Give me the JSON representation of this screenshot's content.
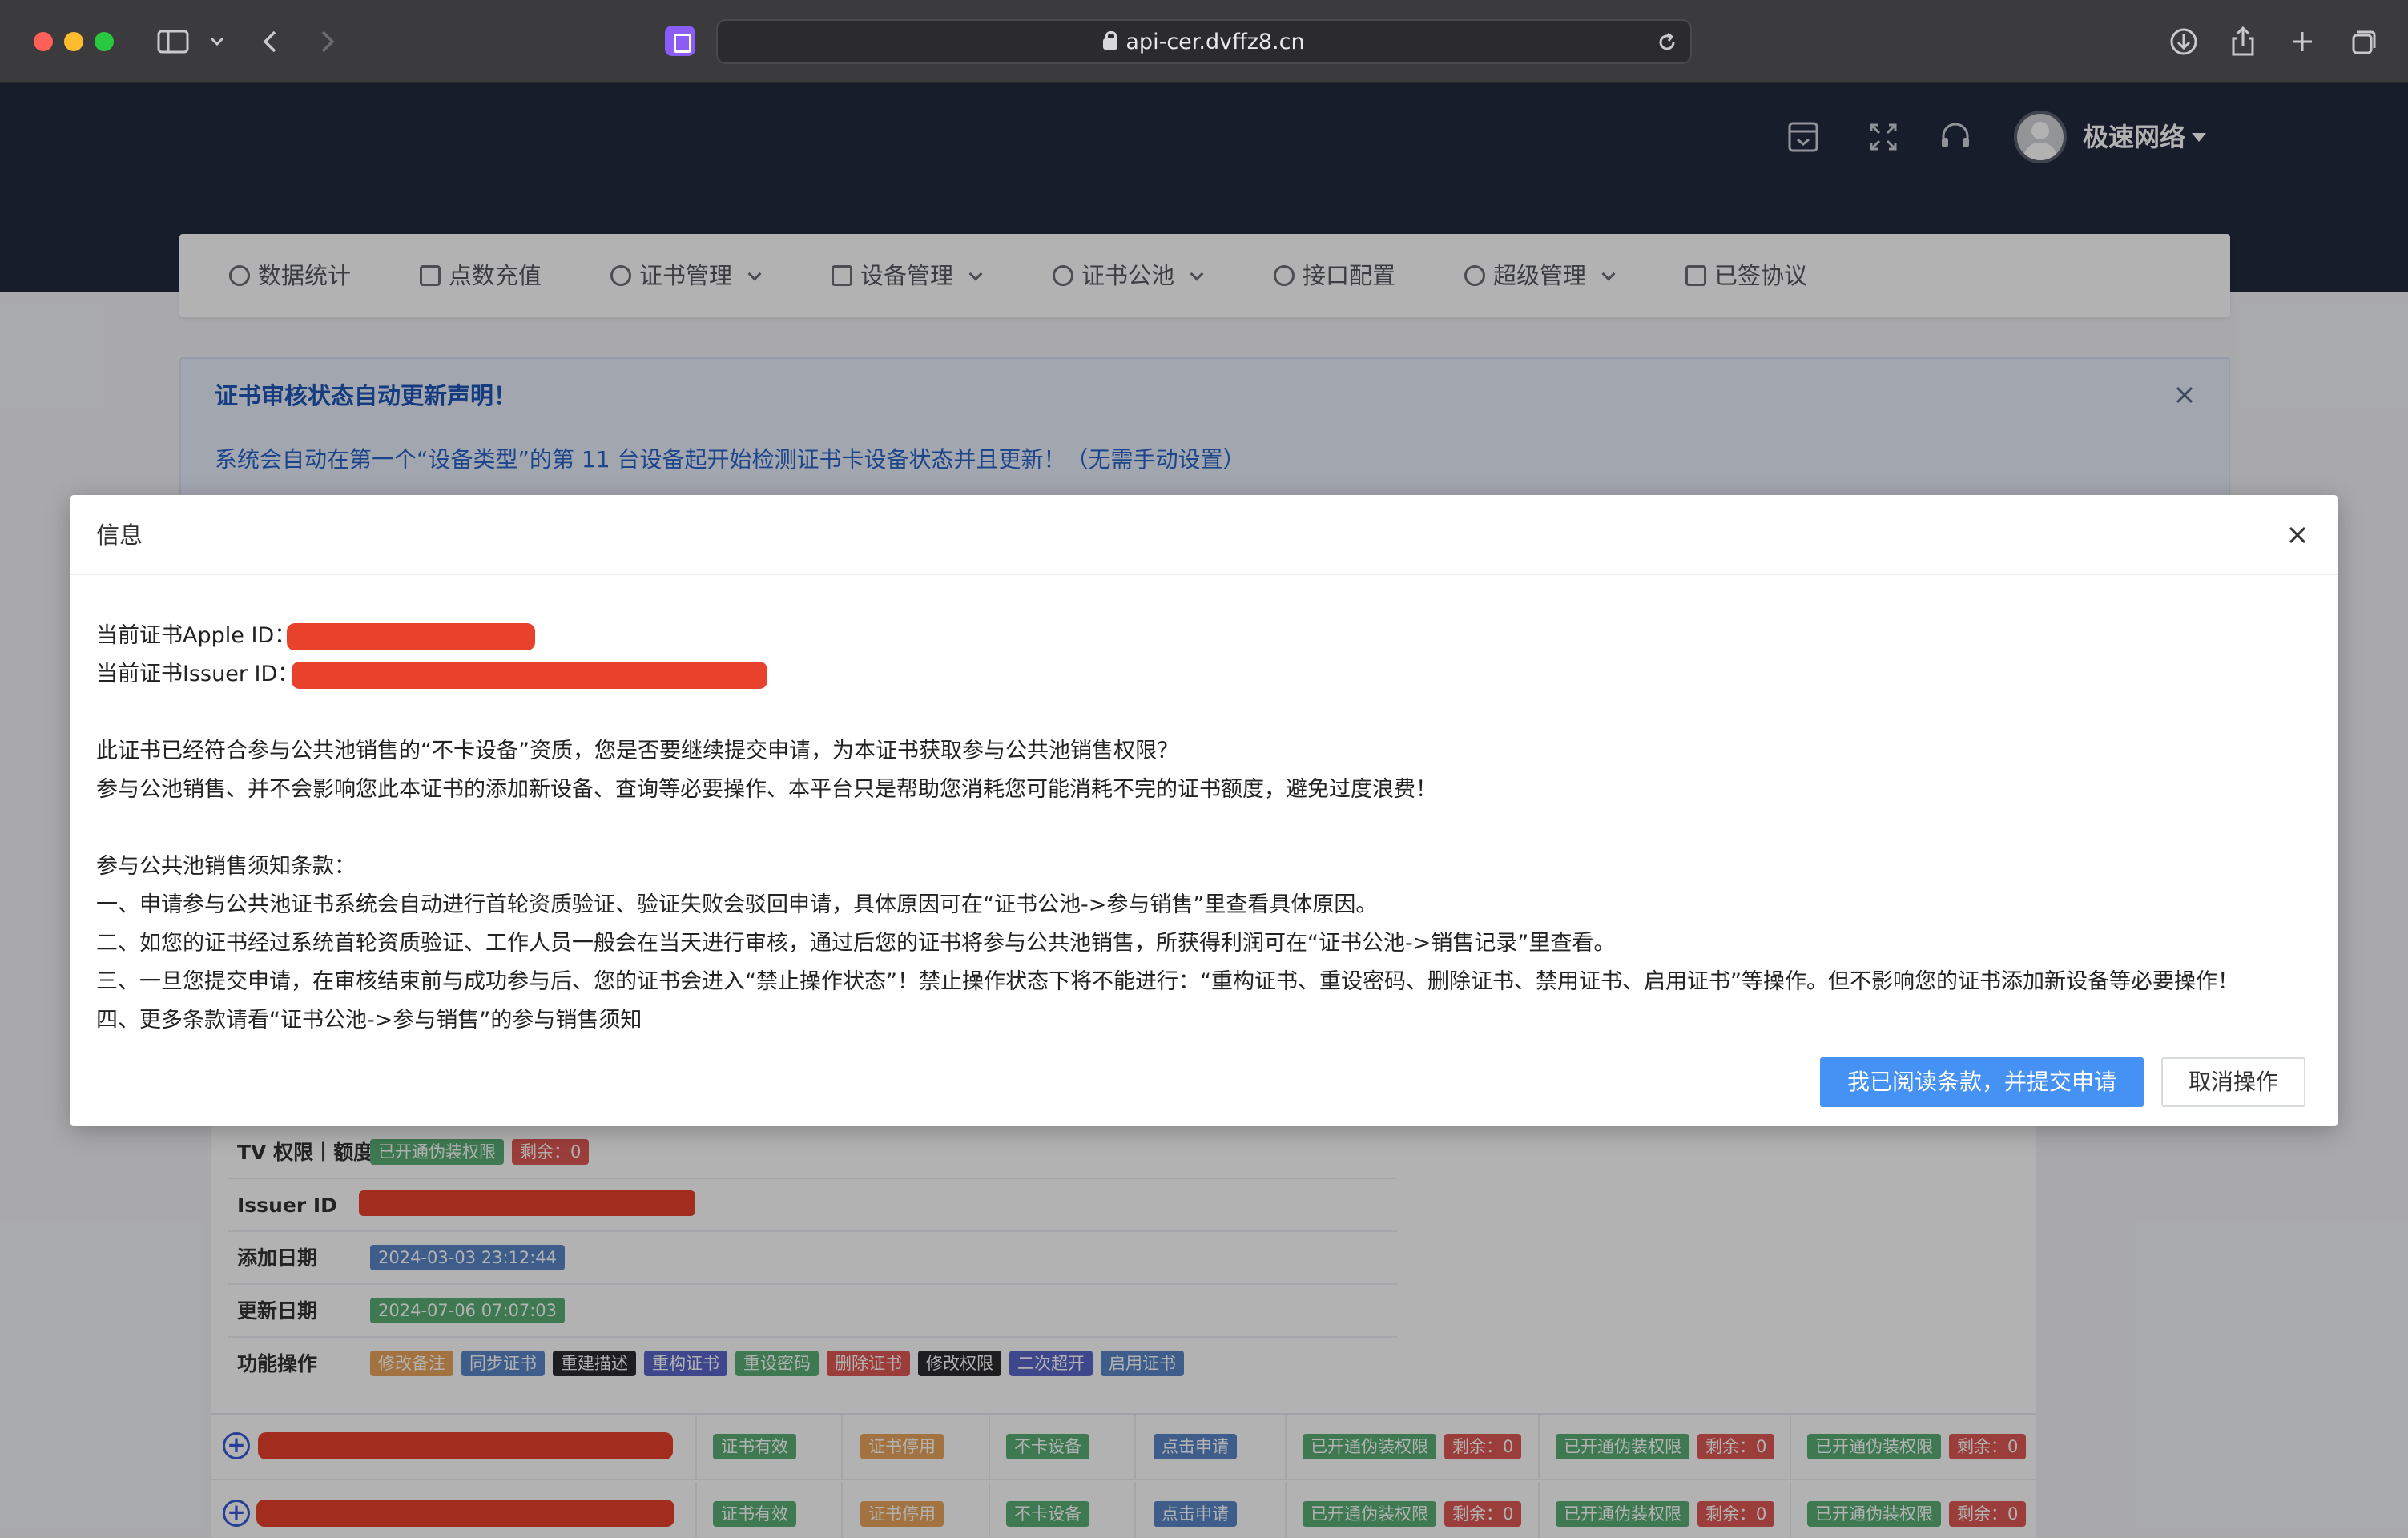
{
  "browser": {
    "url": "api-cer.dvffz8.cn"
  },
  "header": {
    "user_name": "极速网络"
  },
  "nav": {
    "items": [
      {
        "label": "数据统计",
        "has_menu": false
      },
      {
        "label": "点数充值",
        "has_menu": false
      },
      {
        "label": "证书管理",
        "has_menu": true
      },
      {
        "label": "设备管理",
        "has_menu": true
      },
      {
        "label": "证书公池",
        "has_menu": true
      },
      {
        "label": "接口配置",
        "has_menu": false
      },
      {
        "label": "超级管理",
        "has_menu": true
      },
      {
        "label": "已签协议",
        "has_menu": false
      }
    ]
  },
  "notice": {
    "title": "证书审核状态自动更新声明！",
    "text": "系统会自动在第一个“设备类型”的第 11 台设备起开始检测证书卡设备状态并且更新！（无需手动设置）"
  },
  "details": {
    "tv_label": "TV 权限丨额度",
    "tv_tag": "已开通伪装权限",
    "tv_remain": "剩余：0",
    "issuer_label": "Issuer ID",
    "added_label": "添加日期",
    "added_value": "2024-03-03 23:12:44",
    "updated_label": "更新日期",
    "updated_value": "2024-07-06 07:07:03",
    "ops_label": "功能操作",
    "ops": [
      "修改备注",
      "同步证书",
      "重建描述",
      "重构证书",
      "重设密码",
      "删除证书",
      "修改权限",
      "二次超开",
      "启用证书"
    ]
  },
  "table": {
    "cells": [
      "证书有效",
      "证书停用",
      "不卡设备",
      "点击申请"
    ],
    "perm": "已开通伪装权限",
    "remain": "剩余：0"
  },
  "modal": {
    "title": "信息",
    "apple_id_label": "当前证书Apple ID：",
    "issuer_id_label": "当前证书Issuer ID：",
    "para1": "此证书已经符合参与公共池销售的“不卡设备”资质，您是否要继续提交申请，为本证书获取参与公共池销售权限？",
    "para2": "参与公池销售、并不会影响您此本证书的添加新设备、查询等必要操作、本平台只是帮助您消耗您可能消耗不完的证书额度，避免过度浪费！",
    "terms_title": "参与公共池销售须知条款：",
    "term1": "一、申请参与公共池证书系统会自动进行首轮资质验证、验证失败会驳回申请，具体原因可在“证书公池->参与销售”里查看具体原因。",
    "term2": "二、如您的证书经过系统首轮资质验证、工作人员一般会在当天进行审核，通过后您的证书将参与公共池销售，所获得利润可在“证书公池->销售记录”里查看。",
    "term3": "三、一旦您提交申请，在审核结束前与成功参与后、您的证书会进入“禁止操作状态”！禁止操作状态下将不能进行：“重构证书、重设密码、删除证书、禁用证书、启用证书”等操作。但不影响您的证书添加新设备等必要操作！",
    "term4": "四、更多条款请看“证书公池->参与销售”的参与销售须知",
    "confirm_button": "我已阅读条款，并提交申请",
    "cancel_button": "取消操作"
  }
}
